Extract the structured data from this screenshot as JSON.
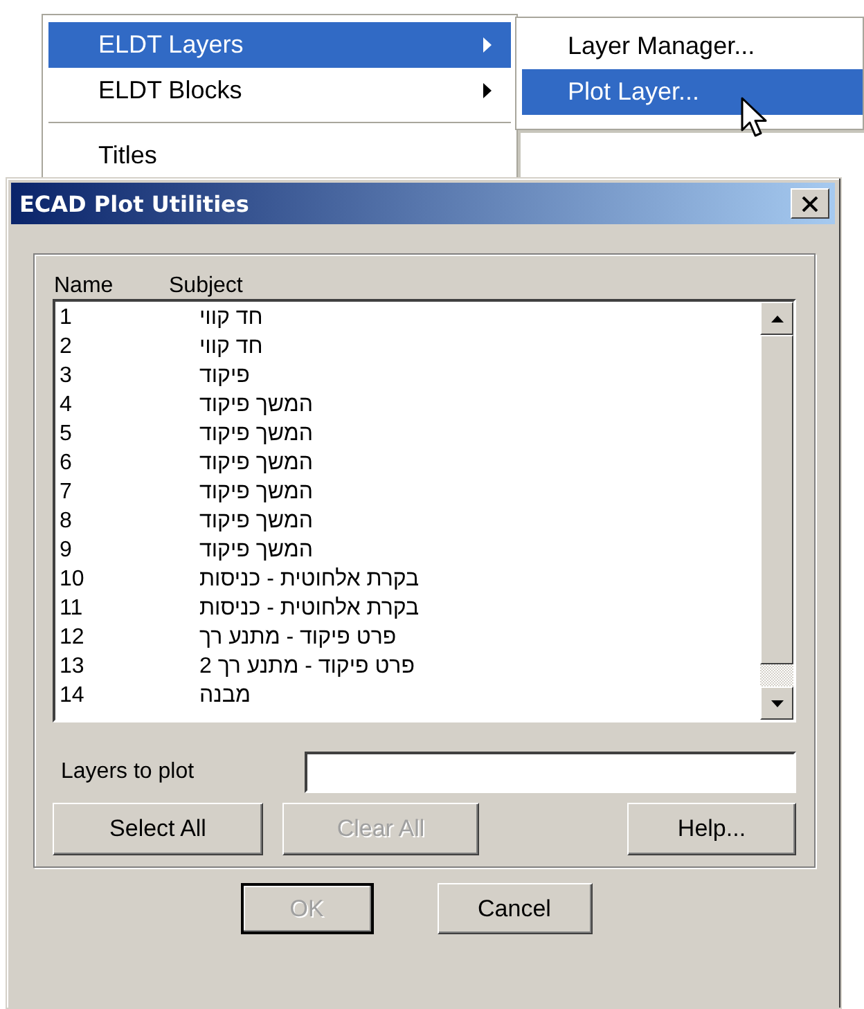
{
  "menu": {
    "items": [
      {
        "kind": "item",
        "label": "ELDT Layers",
        "selected": true,
        "has_submenu": true
      },
      {
        "kind": "item",
        "label": "ELDT Blocks",
        "selected": false,
        "has_submenu": true
      },
      {
        "kind": "separator"
      },
      {
        "kind": "item",
        "label": "Titles",
        "selected": false,
        "has_submenu": false
      }
    ]
  },
  "submenu": {
    "items": [
      {
        "label": "Layer Manager...",
        "selected": false
      },
      {
        "label": "Plot Layer...",
        "selected": true
      }
    ]
  },
  "dialog": {
    "title": "ECAD Plot Utilities",
    "column_headers": {
      "name": "Name",
      "subject": "Subject"
    },
    "rows": [
      {
        "name": "1",
        "subject": "חד קווי"
      },
      {
        "name": "2",
        "subject": "חד קווי"
      },
      {
        "name": "3",
        "subject": "פיקוד"
      },
      {
        "name": "4",
        "subject": "המשך פיקוד"
      },
      {
        "name": "5",
        "subject": "המשך פיקוד"
      },
      {
        "name": "6",
        "subject": "המשך פיקוד"
      },
      {
        "name": "7",
        "subject": "המשך פיקוד"
      },
      {
        "name": "8",
        "subject": "המשך פיקוד"
      },
      {
        "name": "9",
        "subject": "המשך פיקוד"
      },
      {
        "name": "10",
        "subject": "בקרת אלחוטית - כניסות"
      },
      {
        "name": "11",
        "subject": "בקרת אלחוטית - כניסות"
      },
      {
        "name": "12",
        "subject": "פרט פיקוד - מתנע רך"
      },
      {
        "name": "13",
        "subject": "פרט פיקוד - מתנע רך 2"
      },
      {
        "name": "14",
        "subject": "מבנה"
      }
    ],
    "field": {
      "label": "Layers to plot"
    },
    "buttons": {
      "select_all": {
        "label": "Select All",
        "disabled": false
      },
      "clear_all": {
        "label": "Clear All",
        "disabled": true
      },
      "help": {
        "label": "Help...",
        "disabled": false
      }
    },
    "footer_buttons": {
      "ok": {
        "label": "OK",
        "disabled": true,
        "default": true
      },
      "cancel": {
        "label": "Cancel",
        "disabled": false,
        "default": false
      }
    }
  }
}
